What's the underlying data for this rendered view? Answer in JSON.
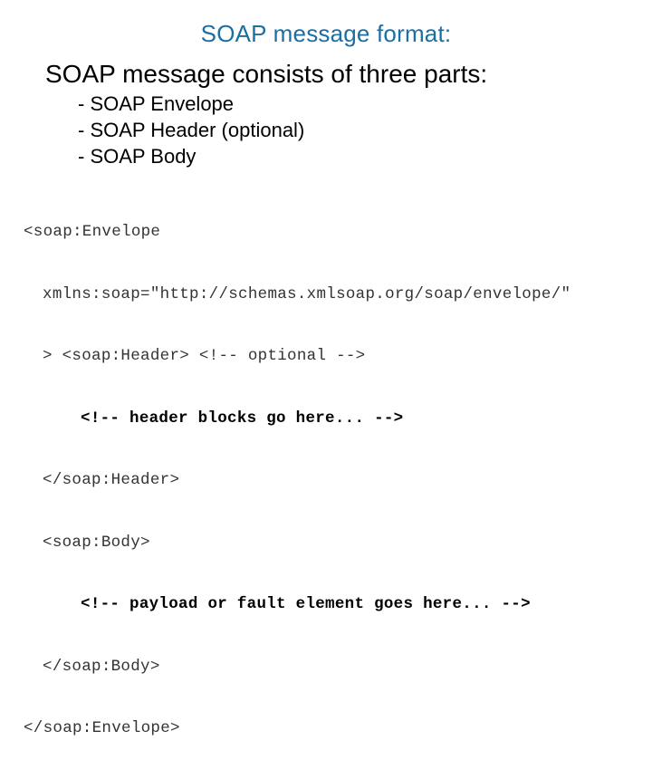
{
  "slide": {
    "title": "SOAP message format:",
    "intro": "SOAP message consists of three parts:",
    "parts": [
      "- SOAP Envelope",
      "- SOAP Header (optional)",
      "- SOAP Body"
    ],
    "code_lines": [
      {
        "indent": "",
        "text": "<soap:Envelope",
        "style": "light"
      },
      {
        "indent": "  ",
        "text": "xmlns:soap=\"http://schemas.xmlsoap.org/soap/envelope/\"",
        "style": "light"
      },
      {
        "indent": "  ",
        "text": "> <soap:Header> <!-- optional -->",
        "style": "light"
      },
      {
        "indent": "      ",
        "text": "<!-- header blocks go here... -->",
        "style": "bold"
      },
      {
        "indent": "  ",
        "text": "</soap:Header>",
        "style": "light"
      },
      {
        "indent": "  ",
        "text": "<soap:Body>",
        "style": "light"
      },
      {
        "indent": "      ",
        "text": "<!-- payload or fault element goes here... -->",
        "style": "bold"
      },
      {
        "indent": "  ",
        "text": "</soap:Body>",
        "style": "light"
      },
      {
        "indent": "",
        "text": "</soap:Envelope>",
        "style": "light"
      }
    ]
  },
  "colors": {
    "title": "#1b6fa3",
    "text": "#000000",
    "background": "#ffffff"
  }
}
